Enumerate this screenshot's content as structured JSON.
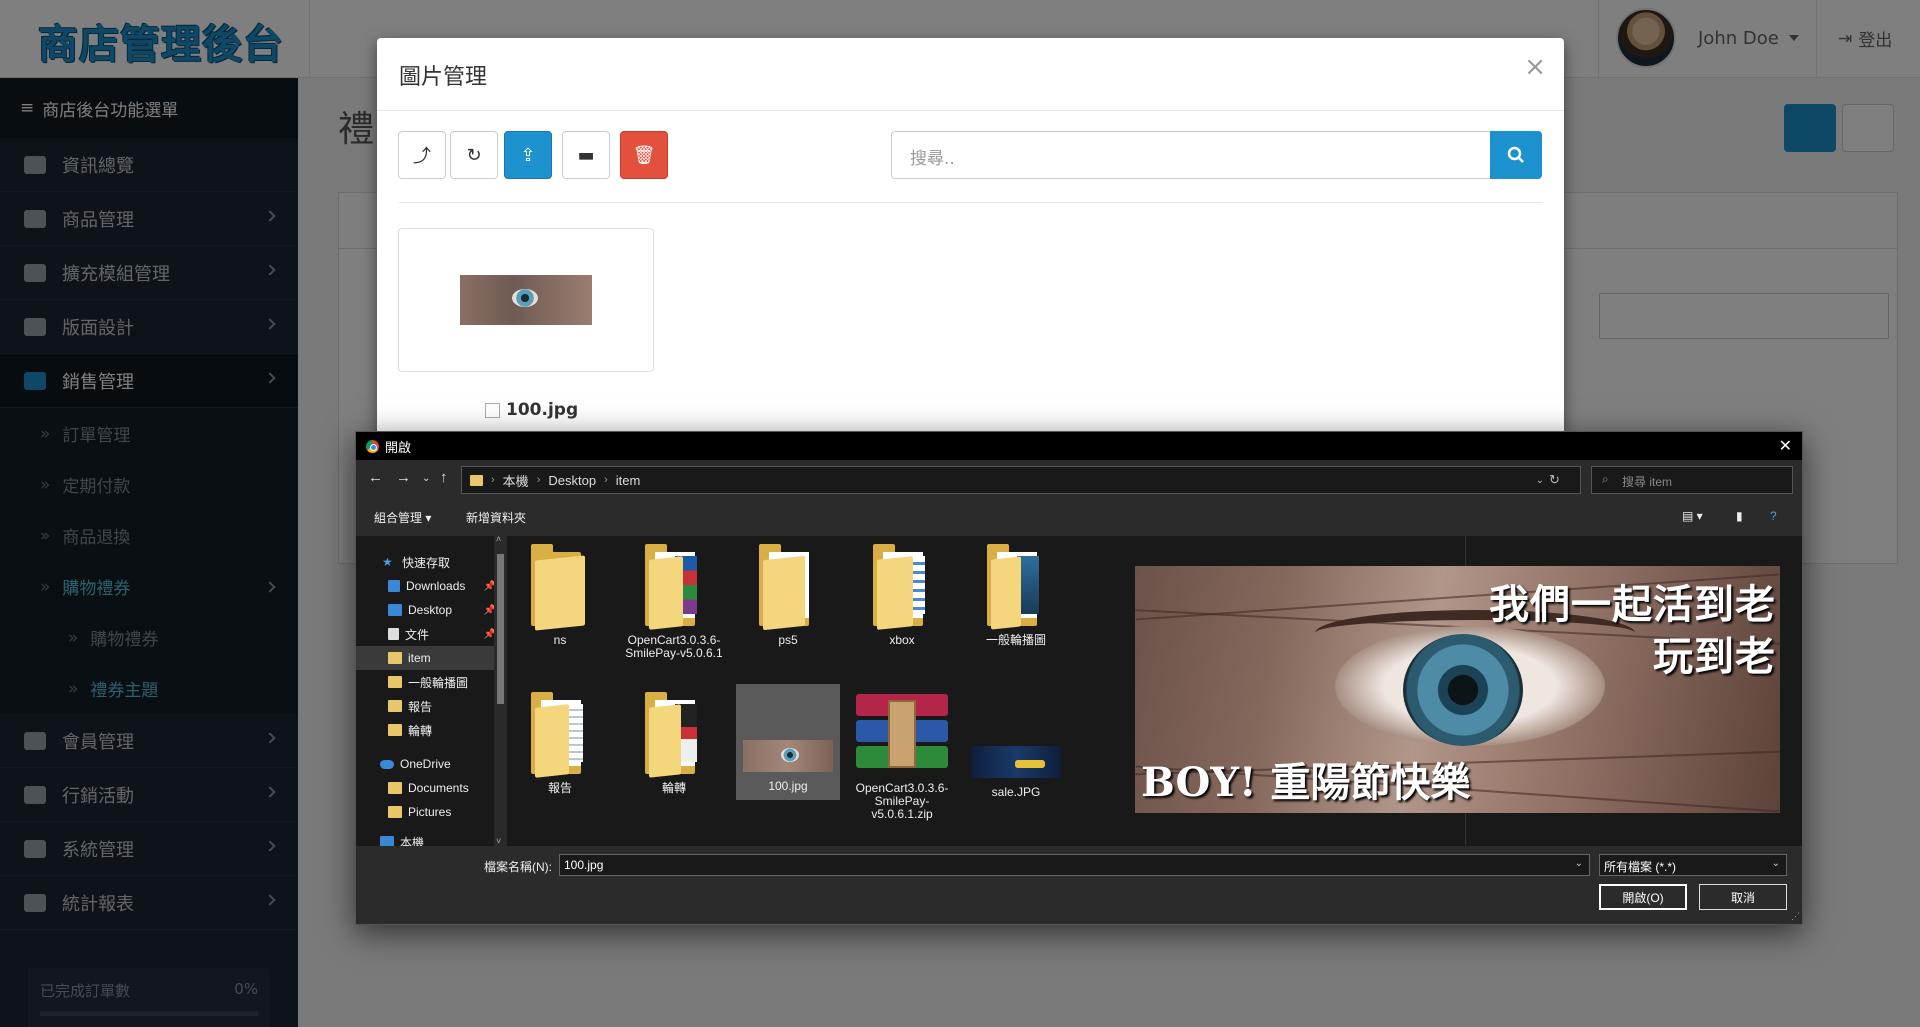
{
  "header": {
    "logo": "商店管理後台",
    "user_name": "John Doe",
    "logout": "登出"
  },
  "sidebar": {
    "title": "商店後台功能選單",
    "items": [
      {
        "label": "資訊總覽"
      },
      {
        "label": "商品管理"
      },
      {
        "label": "擴充模組管理"
      },
      {
        "label": "版面設計"
      },
      {
        "label": "銷售管理"
      }
    ],
    "sales_sub": [
      {
        "label": "訂單管理"
      },
      {
        "label": "定期付款"
      },
      {
        "label": "商品退換"
      },
      {
        "label": "購物禮券"
      }
    ],
    "voucher_sub": [
      {
        "label": "購物禮券"
      },
      {
        "label": "禮券主題"
      }
    ],
    "bottom_items": [
      {
        "label": "會員管理"
      },
      {
        "label": "行銷活動"
      },
      {
        "label": "系統管理"
      },
      {
        "label": "統計報表"
      }
    ],
    "progress": {
      "label": "已完成訂單數",
      "value_text": "0%",
      "value": 0
    }
  },
  "main": {
    "page_title_partial": "禮"
  },
  "image_manager": {
    "title": "圖片管理",
    "close": "×",
    "search_placeholder": "搜尋..",
    "toolbar_icons": [
      "parent-folder-icon",
      "refresh-icon",
      "upload-icon",
      "new-folder-icon",
      "delete-icon"
    ],
    "images": [
      {
        "name": "100.jpg"
      }
    ]
  },
  "open_dialog": {
    "title": "開啟",
    "breadcrumb": [
      "本機",
      "Desktop",
      "item"
    ],
    "search_placeholder": "搜尋 item",
    "organize": "組合管理",
    "new_folder": "新增資料夾",
    "tree": [
      {
        "label": "快速存取"
      },
      {
        "label": "Downloads"
      },
      {
        "label": "Desktop"
      },
      {
        "label": "文件"
      },
      {
        "label": "item"
      },
      {
        "label": "一般輪播圖"
      },
      {
        "label": "報告"
      },
      {
        "label": "輪轉"
      },
      {
        "label": "OneDrive"
      },
      {
        "label": "Documents"
      },
      {
        "label": "Pictures"
      },
      {
        "label": "本機"
      }
    ],
    "files": [
      {
        "name": "ns"
      },
      {
        "name": "OpenCart3.0.3.6-SmilePay-v5.0.6.1"
      },
      {
        "name": "ps5"
      },
      {
        "name": "xbox"
      },
      {
        "name": "一般輪播圖"
      },
      {
        "name": "報告"
      },
      {
        "name": "輪轉"
      },
      {
        "name": "100.jpg"
      },
      {
        "name": "OpenCart3.0.3.6-SmilePay-v5.0.6.1.zip"
      },
      {
        "name": "sale.JPG"
      }
    ],
    "preview_text": {
      "line1": "我們一起活到老",
      "line2": "玩到老",
      "line3": "BOY!  重陽節快樂"
    },
    "filename_label": "檔案名稱(N):",
    "filename_value": "100.jpg",
    "filetype_value": "所有檔案 (*.*)",
    "open_button": "開啟(O)",
    "cancel_button": "取消"
  }
}
